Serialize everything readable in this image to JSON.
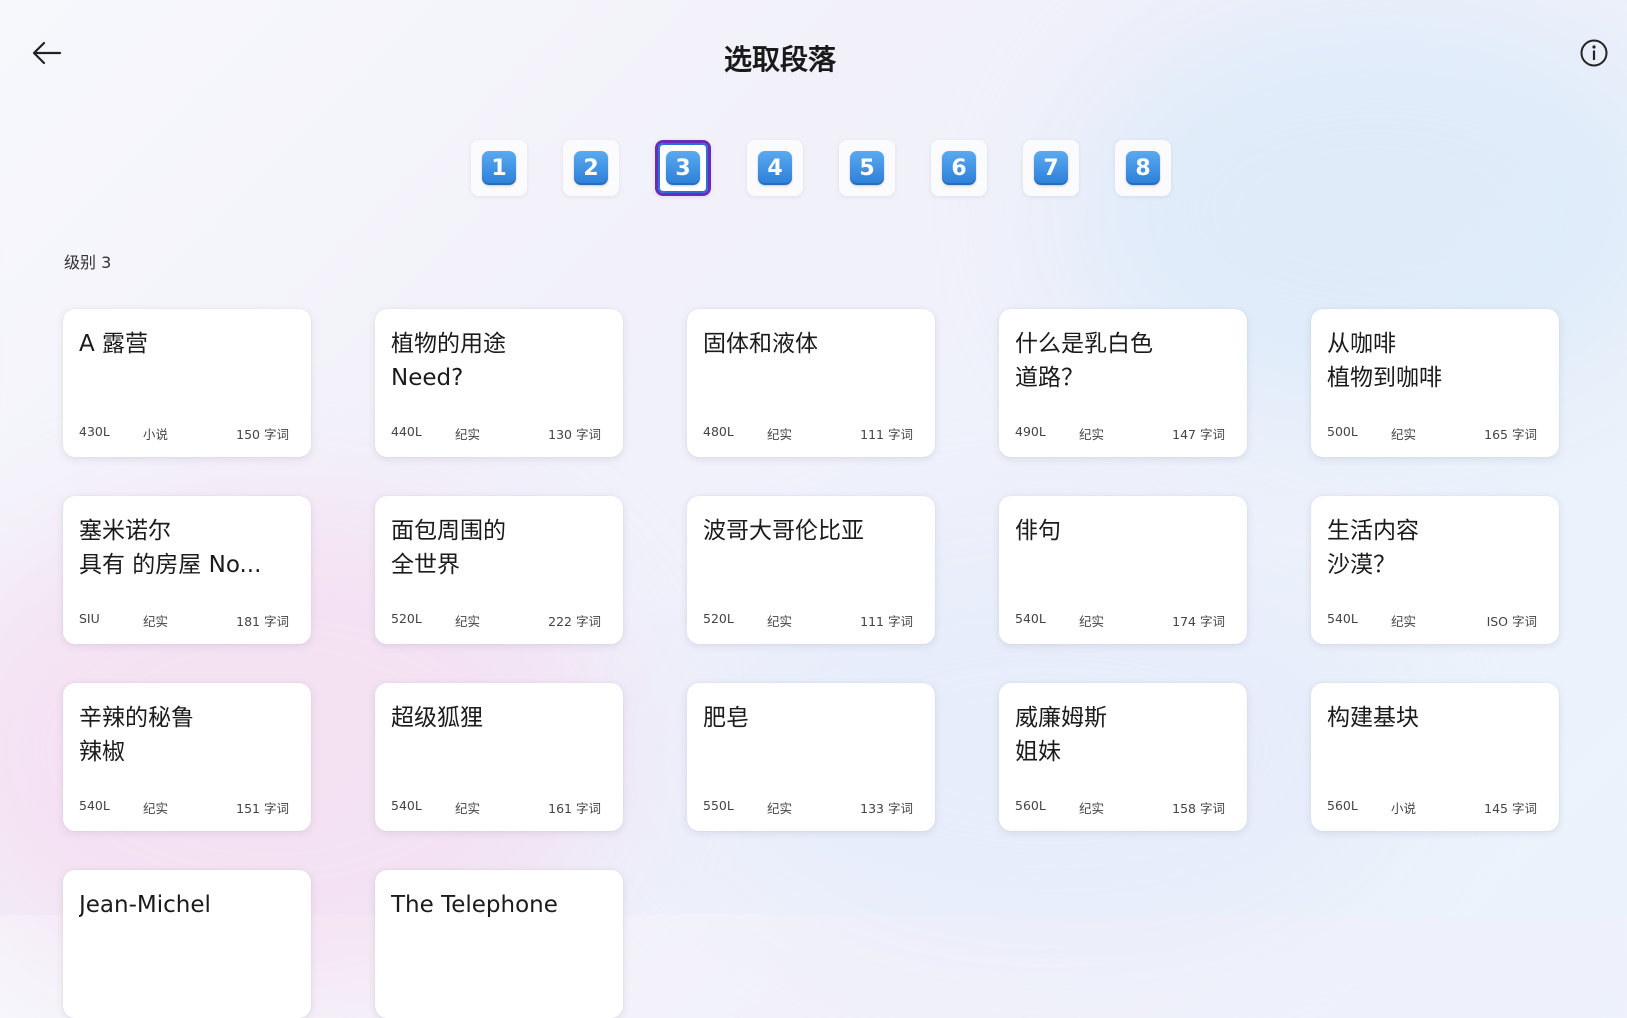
{
  "header": {
    "title": "选取段落",
    "back_icon": "arrow-left-icon",
    "info_icon": "info-circle-icon"
  },
  "levels": {
    "items": [
      "1",
      "2",
      "3",
      "4",
      "5",
      "6",
      "7",
      "8"
    ],
    "selected": "3"
  },
  "section_label": "级别 3",
  "cards": [
    {
      "title": "A 露营",
      "lexile": "430L",
      "genre": "小说",
      "words": "150 字词"
    },
    {
      "title": "植物的用途\nNeed?",
      "lexile": "440L",
      "genre": "纪实",
      "words": "130 字词"
    },
    {
      "title": "固体和液体",
      "lexile": "480L",
      "genre": "纪实",
      "words": "111 字词"
    },
    {
      "title": "什么是乳白色\n道路？",
      "lexile": "490L",
      "genre": "纪实",
      "words": "147 字词"
    },
    {
      "title": "从咖啡\n植物到咖啡",
      "lexile": "500L",
      "genre": "纪实",
      "words": "165 字词"
    },
    {
      "title": "塞米诺尔\n具有 的房屋   No...",
      "lexile": "SIU",
      "genre": "纪实",
      "words": "181 字词"
    },
    {
      "title": "面包周围的\n全世界",
      "lexile": "520L",
      "genre": "纪实",
      "words": "222 字词"
    },
    {
      "title": "波哥大哥伦比亚",
      "lexile": "520L",
      "genre": "纪实",
      "words": "111 字词"
    },
    {
      "title": "俳句",
      "lexile": "540L",
      "genre": "纪实",
      "words": "174 字词"
    },
    {
      "title": "生活内容\n沙漠？",
      "lexile": "540L",
      "genre": "纪实",
      "words": "ISO 字词"
    },
    {
      "title": "辛辣的秘鲁\n辣椒",
      "lexile": "540L",
      "genre": "纪实",
      "words": "151 字词"
    },
    {
      "title": "超级狐狸",
      "lexile": "540L",
      "genre": "纪实",
      "words": "161 字词"
    },
    {
      "title": "肥皂",
      "lexile": "550L",
      "genre": "纪实",
      "words": "133 字词"
    },
    {
      "title": "威廉姆斯\n姐妹",
      "lexile": "560L",
      "genre": "纪实",
      "words": "158 字词"
    },
    {
      "title": "构建基块",
      "lexile": "560L",
      "genre": "小说",
      "words": "145 字词"
    },
    {
      "title": "Jean-Michel",
      "lexile": "",
      "genre": "",
      "words": ""
    },
    {
      "title": "The Telephone",
      "lexile": "",
      "genre": "",
      "words": ""
    }
  ]
}
